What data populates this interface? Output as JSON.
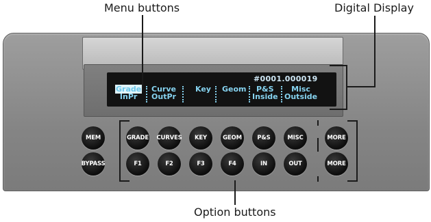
{
  "callouts": {
    "menu_buttons": "Menu buttons",
    "digital_display": "Digital Display",
    "option_buttons": "Option buttons"
  },
  "display": {
    "counter": "#0001.000019",
    "columns": [
      {
        "top": "Grade",
        "bottom": "InPr",
        "selected": true
      },
      {
        "top": "Curve",
        "bottom": "OutPr"
      },
      {
        "top": "Key",
        "bottom": ""
      },
      {
        "top": "Geom",
        "bottom": ""
      },
      {
        "top": "P&S",
        "bottom": "Inside"
      },
      {
        "top": "Misc",
        "bottom": "Outside"
      }
    ]
  },
  "buttons": {
    "row1": [
      "MEM",
      "GRADE",
      "CURVES",
      "KEY",
      "GEOM",
      "P&S",
      "MISC",
      "MORE"
    ],
    "row2": [
      "BYPASS",
      "F1",
      "F2",
      "F3",
      "F4",
      "IN",
      "OUT",
      "MORE"
    ]
  },
  "colors": {
    "panel": "#858585",
    "screen": "#121212",
    "display_text": "#86d3f0",
    "button": "#0d0d0d"
  }
}
